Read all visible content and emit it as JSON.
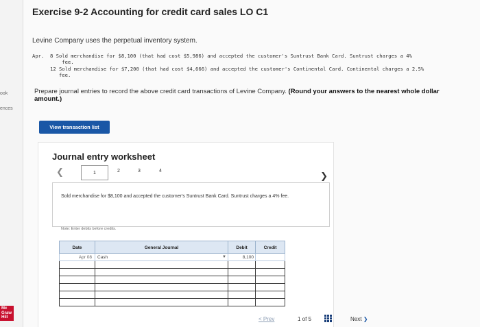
{
  "sidebar": {
    "book_label": "ook",
    "refs_label": "ences",
    "logo_text": "Mc Graw Hill"
  },
  "header": {
    "title": "Exercise 9-2 Accounting for credit card sales LO C1"
  },
  "problem": {
    "intro": "Levine Company uses the perpetual inventory system.",
    "transactions": [
      "Apr.  8 Sold merchandise for $8,100 (that had cost $5,986) and accepted the customer's Suntrust Bank Card. Suntrust charges a 4%\n          fee.",
      "12 Sold merchandise for $7,200 (that had cost $4,666) and accepted the customer's Continental Card. Continental charges a 2.5%\n   fee."
    ],
    "instructions_plain": "Prepare journal entries to record the above credit card transactions of Levine Company. ",
    "instructions_bold": "(Round your answers to the nearest whole dollar amount.)"
  },
  "buttons": {
    "view_transaction_list": "View transaction list"
  },
  "worksheet": {
    "title": "Journal entry worksheet",
    "pages": [
      "1",
      "2",
      "3",
      "4"
    ],
    "current_page": "1",
    "description": "Sold merchandise for $8,100 and accepted the customer's Suntrust Bank Card. Suntrust charges a 4% fee.",
    "note": "Note: Enter debits before credits.",
    "columns": {
      "date": "Date",
      "account": "General Journal",
      "debit": "Debit",
      "credit": "Credit"
    },
    "rows": [
      {
        "date": "Apr 08",
        "account": "Cash",
        "debit": "8,100",
        "credit": ""
      },
      {
        "date": "",
        "account": "",
        "debit": "",
        "credit": ""
      },
      {
        "date": "",
        "account": "",
        "debit": "",
        "credit": ""
      },
      {
        "date": "",
        "account": "",
        "debit": "",
        "credit": ""
      },
      {
        "date": "",
        "account": "",
        "debit": "",
        "credit": ""
      },
      {
        "date": "",
        "account": "",
        "debit": "",
        "credit": ""
      },
      {
        "date": "",
        "account": "",
        "debit": "",
        "credit": ""
      }
    ]
  },
  "footer_nav": {
    "prev": "Prev",
    "page_indicator": "1 of 5",
    "next": "Next"
  },
  "colors": {
    "primary_button": "#1a57a6",
    "header_cell": "#dde7f3",
    "brand_logo": "#c8102e"
  }
}
